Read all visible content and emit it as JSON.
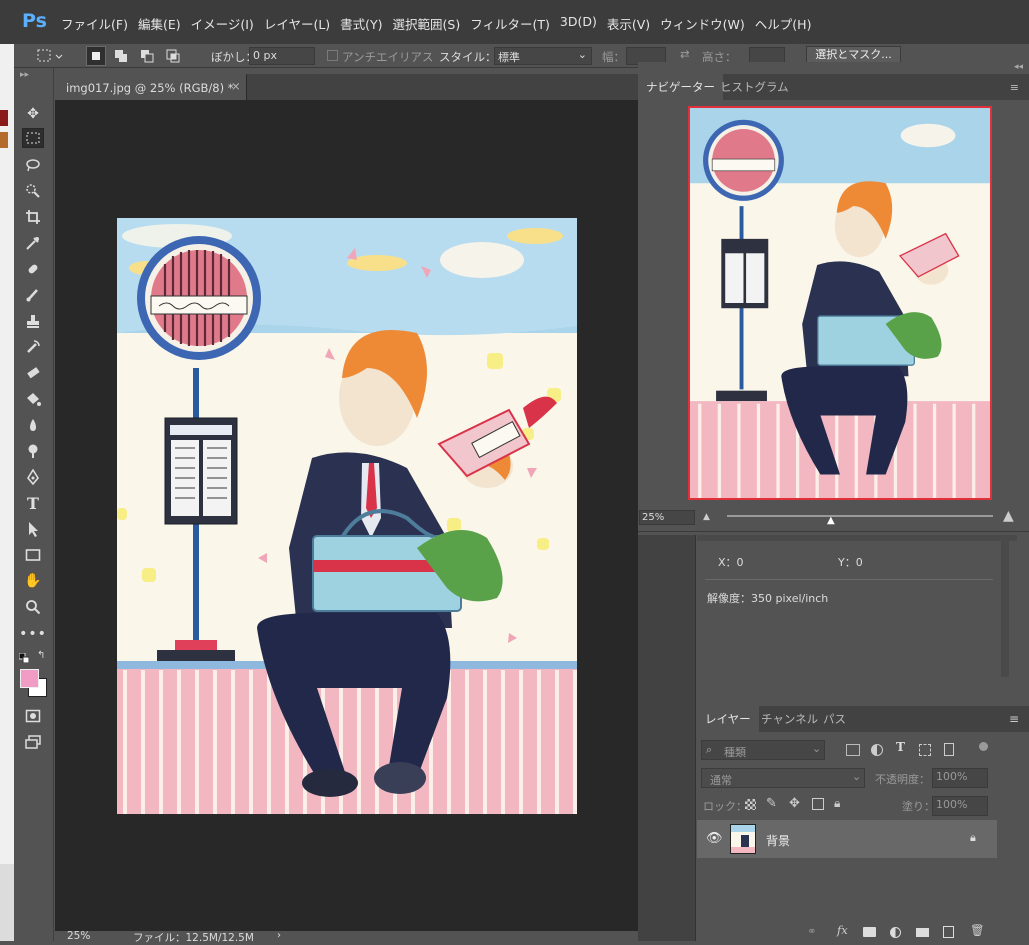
{
  "app": {
    "logo": "Ps"
  },
  "menu": [
    "ファイル(F)",
    "編集(E)",
    "イメージ(I)",
    "レイヤー(L)",
    "書式(Y)",
    "選択範囲(S)",
    "フィルター(T)",
    "3D(D)",
    "表示(V)",
    "ウィンドウ(W)",
    "ヘルプ(H)"
  ],
  "options": {
    "feather_label": "ぼかし：",
    "feather_value": "0 px",
    "antialias_label": "アンチエイリアス",
    "style_label": "スタイル：",
    "style_value": "標準",
    "width_label": "幅：",
    "height_label": "高さ：",
    "mask_button": "選択とマスク..."
  },
  "document": {
    "tab_title": "img017.jpg @ 25% (RGB/8) *",
    "zoom_status": "25%",
    "file_status": "ファイル：12.5M/12.5M"
  },
  "navigator": {
    "tab_navigator": "ナビゲーター",
    "tab_histogram": "ヒストグラム",
    "zoom": "25%"
  },
  "info": {
    "x_label": "X：0",
    "y_label": "Y：0",
    "resolution": "解像度：350 pixel/inch"
  },
  "layers": {
    "tab_layers": "レイヤー",
    "tab_channels": "チャンネル",
    "tab_paths": "パス",
    "filter_kind": "種類",
    "blend_mode": "通常",
    "opacity_label": "不透明度：",
    "opacity_value": "100%",
    "lock_label": "ロック：",
    "fill_label": "塗り：",
    "fill_value": "100%",
    "layer_name": "背景"
  },
  "colors": {
    "accent": "#4f9bd9",
    "foreground_swatch": "#f09cc4",
    "background_swatch": "#ffffff"
  }
}
